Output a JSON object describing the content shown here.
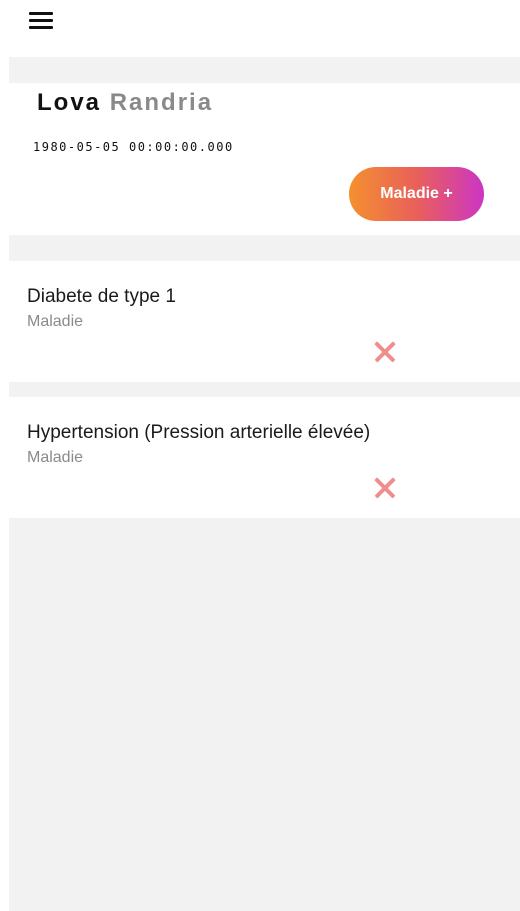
{
  "header": {
    "menu_icon": "hamburger-menu-icon"
  },
  "patient": {
    "first_name": "Lova",
    "last_name": "Randria",
    "birthdate": "1980-05-05 00:00:00.000",
    "add_button_label": "Maladie +"
  },
  "diseases": [
    {
      "name": "Diabete de type 1",
      "type": "Maladie",
      "delete_icon": "close-icon"
    },
    {
      "name": "Hypertension (Pression arterielle élevée)",
      "type": "Maladie",
      "delete_icon": "close-icon"
    }
  ],
  "colors": {
    "button_gradient_start": "#f4902f",
    "button_gradient_end": "#cc35c5",
    "delete_icon": "#f08e8e",
    "background": "#f2f2f2"
  }
}
